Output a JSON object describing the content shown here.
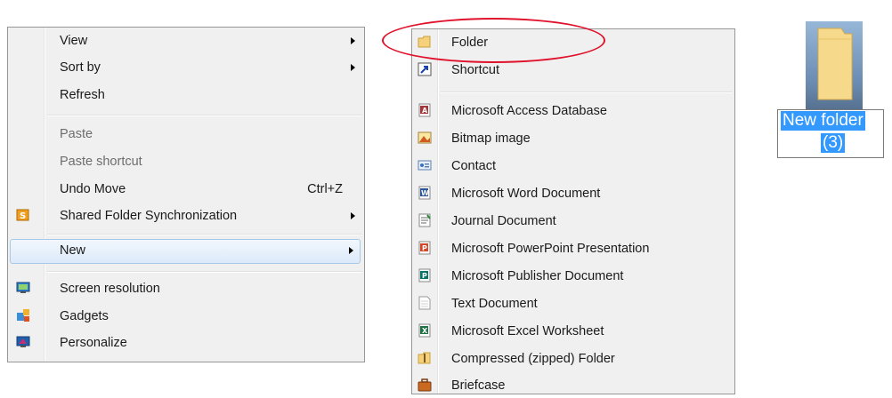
{
  "context_menu": {
    "items": [
      {
        "label": "View",
        "submenu": true
      },
      {
        "label": "Sort by",
        "submenu": true
      },
      {
        "label": "Refresh"
      },
      {
        "label": "Paste",
        "disabled": true
      },
      {
        "label": "Paste shortcut",
        "disabled": true
      },
      {
        "label": "Undo Move",
        "shortcut": "Ctrl+Z"
      },
      {
        "label": "Shared Folder Synchronization",
        "icon": "shared-folder-sync-icon",
        "submenu": true
      },
      {
        "label": "New",
        "submenu": true,
        "highlighted": true
      },
      {
        "label": "Screen resolution",
        "icon": "screen-resolution-icon"
      },
      {
        "label": "Gadgets",
        "icon": "gadgets-icon"
      },
      {
        "label": "Personalize",
        "icon": "personalize-icon"
      }
    ]
  },
  "new_submenu": {
    "items": [
      {
        "label": "Folder",
        "icon": "folder-icon"
      },
      {
        "label": "Shortcut",
        "icon": "shortcut-icon"
      },
      {
        "label": "Microsoft Access Database",
        "icon": "access-icon"
      },
      {
        "label": "Bitmap image",
        "icon": "bitmap-icon"
      },
      {
        "label": "Contact",
        "icon": "contact-icon"
      },
      {
        "label": "Microsoft Word Document",
        "icon": "word-icon"
      },
      {
        "label": "Journal Document",
        "icon": "journal-icon"
      },
      {
        "label": "Microsoft PowerPoint Presentation",
        "icon": "powerpoint-icon"
      },
      {
        "label": "Microsoft Publisher Document",
        "icon": "publisher-icon"
      },
      {
        "label": "Text Document",
        "icon": "text-document-icon"
      },
      {
        "label": "Microsoft Excel Worksheet",
        "icon": "excel-icon"
      },
      {
        "label": "Compressed (zipped) Folder",
        "icon": "zip-folder-icon"
      },
      {
        "label": "Briefcase",
        "icon": "briefcase-icon"
      }
    ]
  },
  "desktop_icon": {
    "name_line1": "New folder",
    "name_line2": "(3)",
    "icon": "folder-icon"
  },
  "colors": {
    "highlight_oval": "#e0112b",
    "selection": "#3399ff"
  }
}
